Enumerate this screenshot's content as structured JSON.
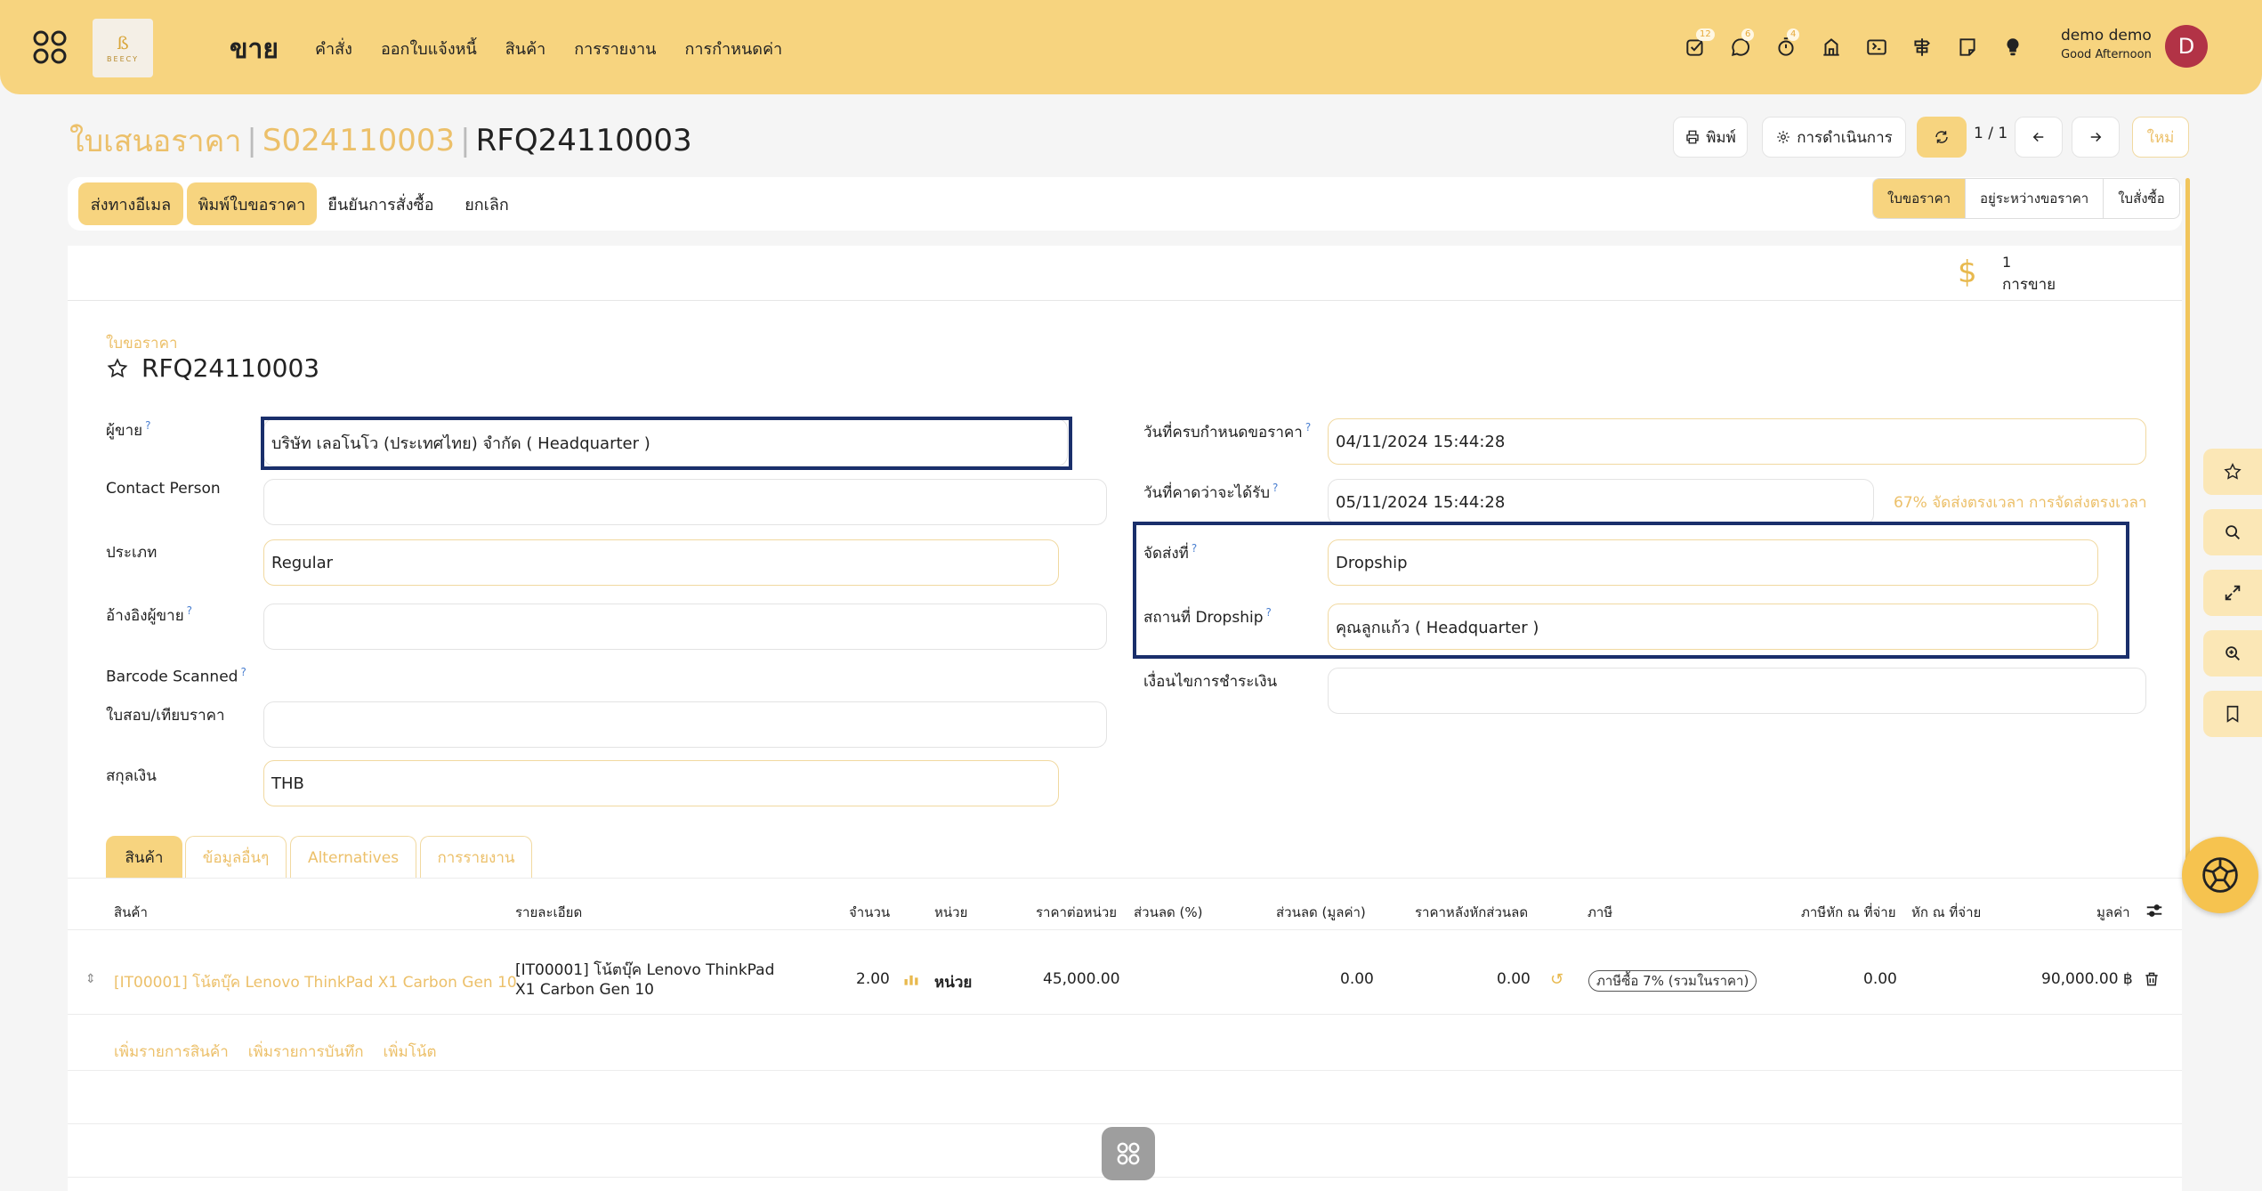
{
  "topbar": {
    "logo_text": "BEECY",
    "brand": "ขาย",
    "nav": [
      "คำสั่ง",
      "ออกใบแจ้งหนี้",
      "สินค้า",
      "การรายงาน",
      "การกำหนดค่า"
    ],
    "badges": {
      "activity": "12",
      "chat": "6",
      "timer": "4"
    },
    "user_name": "demo demo",
    "greeting": "Good Afternoon",
    "avatar_letter": "D",
    "colors": {
      "bar": "#f7d47f",
      "avatar": "#b23346"
    }
  },
  "breadcrumb": {
    "crumb1": "ใบเสนอราคา",
    "crumb2": "S024110003",
    "current": "RFQ24110003"
  },
  "header_buttons": {
    "print": "พิมพ์",
    "action": "การดำเนินการ",
    "pager": "1 / 1",
    "new": "ใหม่"
  },
  "actions": {
    "email": "ส่งทางอีเมล",
    "print_rfq": "พิมพ์ใบขอราคา",
    "confirm": "ยืนยันการสั่งซื้อ",
    "cancel": "ยกเลิก"
  },
  "statusbar": [
    "ใบขอราคา",
    "อยู่ระหว่างขอราคา",
    "ใบสั่งซื้อ"
  ],
  "smart_button": {
    "count": "1",
    "label": "การขาย"
  },
  "form": {
    "subtitle": "ใบขอราคา",
    "title": "RFQ24110003",
    "left": {
      "vendor_label": "ผู้ขาย",
      "vendor_value": "บริษัท เลอโนโว (ประเทศไทย) จำกัด ( Headquarter )",
      "contact_label": "Contact Person",
      "contact_value": "",
      "type_label": "ประเภท",
      "type_value": "Regular",
      "vendor_ref_label": "อ้างอิงผู้ขาย",
      "vendor_ref_value": "",
      "barcode_label": "Barcode Scanned",
      "quote_label": "ใบสอบ/เทียบราคา",
      "quote_value": "",
      "currency_label": "สกุลเงิน",
      "currency_value": "THB"
    },
    "right": {
      "deadline_label": "วันที่ครบกำหนดขอราคา",
      "deadline_value": "04/11/2024 15:44:28",
      "expected_label": "วันที่คาดว่าจะได้รับ",
      "expected_value": "05/11/2024 15:44:28",
      "on_time": "67% จัดส่งตรงเวลา การจัดส่งตรงเวลา",
      "deliver_to_label": "จัดส่งที่",
      "deliver_to_value": "Dropship",
      "dropship_label": "สถานที่ Dropship",
      "dropship_value": "คุณลูกแก้ว ( Headquarter )",
      "payment_label": "เงื่อนไขการชำระเงิน",
      "payment_value": ""
    }
  },
  "tabs": [
    "สินค้า",
    "ข้อมูลอื่นๆ",
    "Alternatives",
    "การรายงาน"
  ],
  "table": {
    "headers": [
      "สินค้า",
      "รายละเอียด",
      "จำนวน",
      "หน่วย",
      "ราคาต่อหน่วย",
      "ส่วนลด (%)",
      "ส่วนลด (มูลค่า)",
      "ราคาหลังหักส่วนลด",
      "ภาษี",
      "ภาษีหัก ณ ที่จ่าย",
      "หัก ณ ที่จ่าย",
      "มูลค่า"
    ],
    "row": {
      "product": "[IT00001] โน้ตบุ๊ค Lenovo ThinkPad X1 Carbon Gen 10",
      "desc_line1": "[IT00001] โน้ตบุ๊ค Lenovo ThinkPad",
      "desc_line2": "X1 Carbon Gen 10",
      "qty": "2.00",
      "uom": "หน่วย",
      "price": "45,000.00",
      "disc_amount": "0.00",
      "after_disc": "0.00",
      "tax": "ภาษีซื้อ 7% (รวมในราคา)",
      "wht": "0.00",
      "subtotal": "90,000.00 ฿"
    },
    "add_links": [
      "เพิ่มรายการสินค้า",
      "เพิ่มรายการบันทึก",
      "เพิ่มโน้ต"
    ]
  }
}
